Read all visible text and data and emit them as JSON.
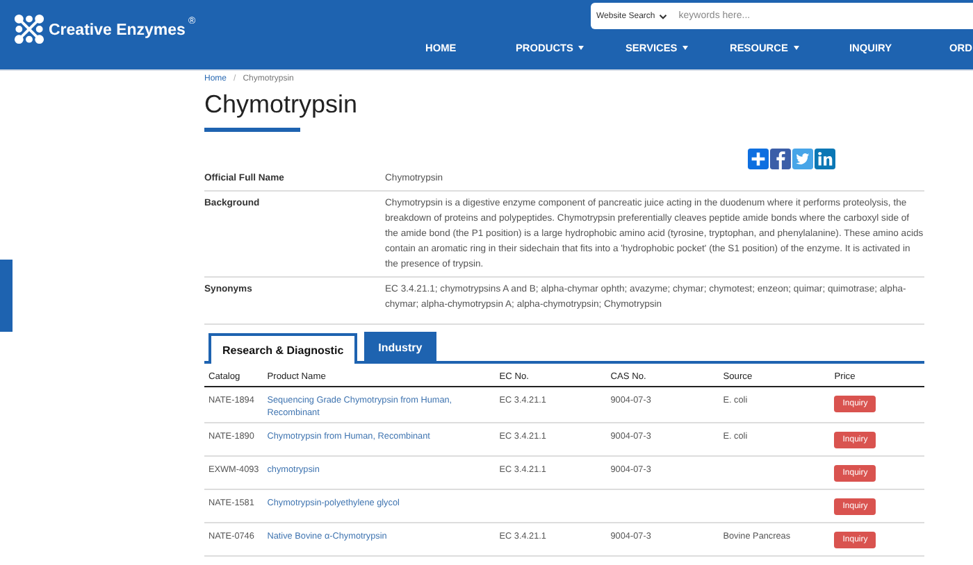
{
  "header": {
    "brand": "Creative Enzymes",
    "brand_mark": "®",
    "search": {
      "scope": "Website Search",
      "placeholder": "keywords here..."
    },
    "nav": [
      {
        "label": "HOME",
        "has_menu": false
      },
      {
        "label": "PRODUCTS",
        "has_menu": true
      },
      {
        "label": "SERVICES",
        "has_menu": true
      },
      {
        "label": "RESOURCE",
        "has_menu": true
      },
      {
        "label": "INQUIRY",
        "has_menu": false
      },
      {
        "label": "ORD"
      }
    ]
  },
  "breadcrumb_separator": "/",
  "breadcrumb": [
    {
      "label": "Home",
      "link": true
    },
    {
      "label": "Chymotrypsin",
      "link": false
    }
  ],
  "title": "Chymotrypsin",
  "details": [
    {
      "label": "Official Full Name",
      "value": "Chymotrypsin"
    },
    {
      "label": "Background",
      "value": "Chymotrypsin is a digestive enzyme component of pancreatic juice acting in the duodenum where it performs proteolysis, the breakdown of proteins and polypeptides. Chymotrypsin preferentially cleaves peptide amide bonds where the carboxyl side of the amide bond (the P1 position) is a large hydrophobic amino acid (tyrosine, tryptophan, and phenylalanine). These amino acids contain an aromatic ring in their sidechain that fits into a 'hydrophobic pocket' (the S1 position) of the enzyme. It is activated in the presence of trypsin."
    },
    {
      "label": "Synonyms",
      "value": "EC 3.4.21.1; chymotrypsins A and B; alpha-chymar ophth; avazyme; chymar; chymotest; enzeon; quimar; quimotrase; alpha-chymar; alpha-chymotrypsin A; alpha-chymotrypsin; Chymotrypsin"
    }
  ],
  "tabs": [
    {
      "label": "Research & Diagnostic",
      "selected": true
    },
    {
      "label": "Industry",
      "selected": false
    }
  ],
  "table": {
    "columns": [
      "Catalog",
      "Product Name",
      "EC No.",
      "CAS No.",
      "Source",
      "Price"
    ],
    "rows": [
      {
        "catalog": "NATE-1894",
        "name": "Sequencing Grade Chymotrypsin from Human, Recombinant",
        "ec": "EC 3.4.21.1",
        "cas": "9004-07-3",
        "source": "E. coli",
        "action": "Inquiry"
      },
      {
        "catalog": "NATE-1890",
        "name": "Chymotrypsin from Human, Recombinant",
        "ec": "EC 3.4.21.1",
        "cas": "9004-07-3",
        "source": "E. coli",
        "action": "Inquiry"
      },
      {
        "catalog": "EXWM-4093",
        "name": "chymotrypsin",
        "ec": "EC 3.4.21.1",
        "cas": "9004-07-3",
        "action": "Inquiry"
      },
      {
        "catalog": "NATE-1581",
        "name": "Chymotrypsin-polyethylene glycol",
        "action": "Inquiry"
      },
      {
        "catalog": "NATE-0746",
        "name": "Native Bovine α-Chymotrypsin",
        "ec": "EC 3.4.21.1",
        "cas": "9004-07-3",
        "source": "Bovine Pancreas",
        "action": "Inquiry"
      }
    ]
  }
}
